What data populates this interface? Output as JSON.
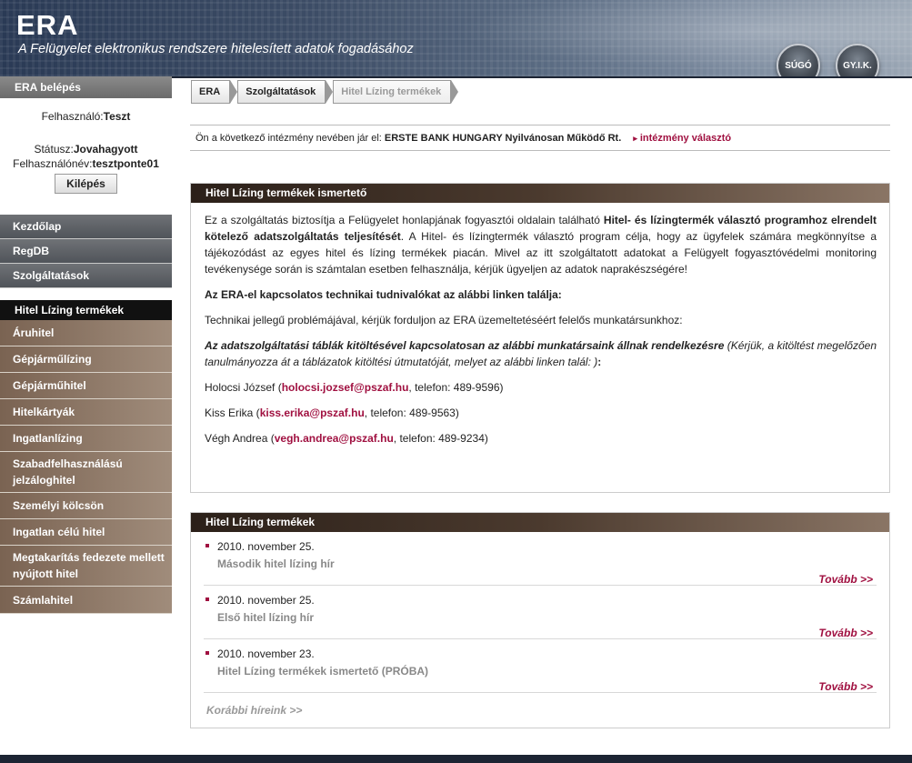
{
  "header": {
    "title": "ERA",
    "subtitle": "A Felügyelet elektronikus rendszere hitelesített adatok fogadásához",
    "help_label": "SÚGÓ",
    "faq_label": "GY.I.K."
  },
  "sidebar": {
    "login_head": "ERA belépés",
    "user_label": "Felhasználó:",
    "user_value": "Teszt",
    "status_label": "Státusz:",
    "status_value": "Jovahagyott",
    "username_label": "Felhasználónév:",
    "username_value": "tesztponte01",
    "logout_label": "Kilépés",
    "main_nav": [
      "Kezdőlap",
      "RegDB",
      "Szolgáltatások"
    ],
    "section_title": "Hitel Lízing termékek",
    "sub_nav": [
      "Áruhitel",
      "Gépjárműlízing",
      "Gépjárműhitel",
      "Hitelkártyák",
      "Ingatlanlízing",
      "Szabadfelhasználású jelzáloghitel",
      "Személyi kölcsön",
      "Ingatlan célú hitel",
      "Megtakarítás fedezete mellett nyújtott hitel",
      "Számlahitel"
    ]
  },
  "breadcrumb": [
    "ERA",
    "Szolgáltatások",
    "Hitel Lízing termékek"
  ],
  "institution": {
    "prefix": "Ön a következő intézmény nevében jár el:",
    "name": "ERSTE BANK HUNGARY Nyilvánosan Működő Rt.",
    "link": "intézmény választó"
  },
  "intro": {
    "title": "Hitel Lízing termékek  ismertető",
    "p1_a": "Ez a szolgáltatás biztosítja a Felügyelet honlapjának fogyasztói oldalain található ",
    "p1_b": "Hitel- és lízingtermék választó programhoz elrendelt kötelező adatszolgáltatás teljesítését",
    "p1_c": ". A Hitel- és lízingtermék választó program célja, hogy az ügyfelek számára megkönnyítse a tájékozódást az egyes hitel és lízing termékek piacán. Mivel az itt szolgáltatott adatokat a Felügyelt fogyasztóvédelmi monitoring tevékenysége során is számtalan esetben felhasználja, kérjük ügyeljen az adatok naprakészségére!",
    "p2": "Az ERA-el kapcsolatos technikai tudnivalókat az alábbi linken találja:",
    "p3": "Technikai jellegű problémájával, kérjük forduljon az ERA üzemeltetéséért felelős munkatársunkhoz:",
    "p4_bold": "Az adatszolgáltatási táblák kitöltésével kapcsolatosan az alábbi munkatársaink állnak rendelkezésre",
    "p4_normal": " (Kérjük, a kitöltést megelőzően tanulmányozza át a táblázatok kitöltési útmutatóját, melyet az alábbi linken talál: )",
    "p4_end": ":",
    "contacts": [
      {
        "name": "Holocsi József (",
        "email": "holocsi.jozsef@pszaf.hu",
        "phone": ", telefon: 489-9596)"
      },
      {
        "name": "Kiss Erika (",
        "email": "kiss.erika@pszaf.hu",
        "phone": ", telefon: 489-9563)"
      },
      {
        "name": "Végh Andrea (",
        "email": "vegh.andrea@pszaf.hu",
        "phone": ", telefon: 489-9234)"
      }
    ]
  },
  "news": {
    "title": "Hitel Lízing termékek",
    "items": [
      {
        "date": "2010. november 25.",
        "title": "Második hitel lízing hír",
        "more": "Tovább >>"
      },
      {
        "date": "2010. november 25.",
        "title": "Első hitel lízing hír",
        "more": "Tovább >>"
      },
      {
        "date": "2010. november 23.",
        "title": "Hitel Lízing termékek ismertető (PRÓBA)",
        "more": "Tovább >>"
      }
    ],
    "older": "Korábbi híreink >>"
  }
}
